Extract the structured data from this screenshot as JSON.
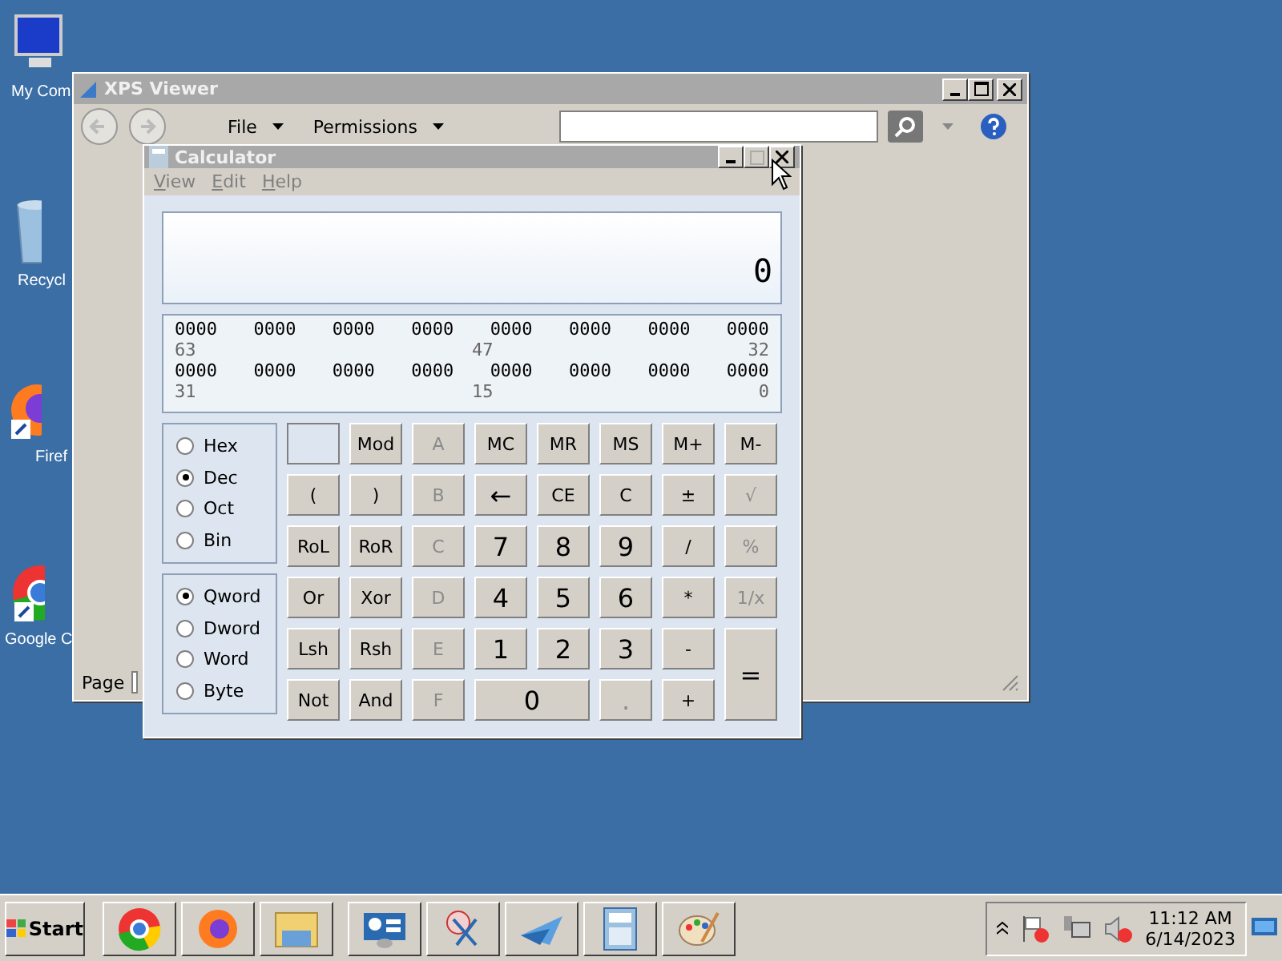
{
  "desktop_icons": [
    {
      "label": "My Com",
      "kind": "computer"
    },
    {
      "label": "Recycl",
      "kind": "bin"
    },
    {
      "label": "Firef",
      "kind": "firefox"
    },
    {
      "label": "Google C",
      "kind": "chrome"
    }
  ],
  "xps_viewer": {
    "title": "XPS Viewer",
    "menu": [
      "File",
      "Permissions"
    ],
    "page_label": "Page"
  },
  "calculator": {
    "title": "Calculator",
    "menu": [
      "View",
      "Edit",
      "Help"
    ],
    "display": "0",
    "bit_rows": [
      {
        "groups": [
          "0000",
          "0000",
          "0000",
          "0000",
          "0000",
          "0000",
          "0000",
          "0000"
        ],
        "marks": [
          "63",
          "47",
          "32"
        ]
      },
      {
        "groups": [
          "0000",
          "0000",
          "0000",
          "0000",
          "0000",
          "0000",
          "0000",
          "0000"
        ],
        "marks": [
          "31",
          "15",
          "0"
        ]
      }
    ],
    "radix": [
      {
        "label": "Hex",
        "selected": false
      },
      {
        "label": "Dec",
        "selected": true
      },
      {
        "label": "Oct",
        "selected": false
      },
      {
        "label": "Bin",
        "selected": false
      }
    ],
    "word_size": [
      {
        "label": "Qword",
        "selected": true
      },
      {
        "label": "Dword",
        "selected": false
      },
      {
        "label": "Word",
        "selected": false
      },
      {
        "label": "Byte",
        "selected": false
      }
    ],
    "keys": [
      {
        "kind": "indicator"
      },
      {
        "kind": "key",
        "label": "Mod",
        "disabled": false
      },
      {
        "kind": "key",
        "label": "A",
        "disabled": true
      },
      {
        "kind": "key",
        "label": "MC",
        "disabled": false
      },
      {
        "kind": "key",
        "label": "MR",
        "disabled": false
      },
      {
        "kind": "key",
        "label": "MS",
        "disabled": false
      },
      {
        "kind": "key",
        "label": "M+",
        "disabled": false
      },
      {
        "kind": "key",
        "label": "M-",
        "disabled": false
      },
      {
        "kind": "key",
        "label": "(",
        "disabled": false
      },
      {
        "kind": "key",
        "label": ")",
        "disabled": false
      },
      {
        "kind": "key",
        "label": "B",
        "disabled": true
      },
      {
        "kind": "key",
        "label": "←",
        "disabled": false
      },
      {
        "kind": "key",
        "label": "CE",
        "disabled": false
      },
      {
        "kind": "key",
        "label": "C",
        "disabled": false
      },
      {
        "kind": "key",
        "label": "±",
        "disabled": false
      },
      {
        "kind": "key",
        "label": "√",
        "disabled": true
      },
      {
        "kind": "key",
        "label": "RoL",
        "disabled": false
      },
      {
        "kind": "key",
        "label": "RoR",
        "disabled": false
      },
      {
        "kind": "key",
        "label": "C",
        "disabled": true
      },
      {
        "kind": "key",
        "label": "7",
        "disabled": false
      },
      {
        "kind": "key",
        "label": "8",
        "disabled": false
      },
      {
        "kind": "key",
        "label": "9",
        "disabled": false
      },
      {
        "kind": "key",
        "label": "/",
        "disabled": false
      },
      {
        "kind": "key",
        "label": "%",
        "disabled": true
      },
      {
        "kind": "key",
        "label": "Or",
        "disabled": false
      },
      {
        "kind": "key",
        "label": "Xor",
        "disabled": false
      },
      {
        "kind": "key",
        "label": "D",
        "disabled": true
      },
      {
        "kind": "key",
        "label": "4",
        "disabled": false
      },
      {
        "kind": "key",
        "label": "5",
        "disabled": false
      },
      {
        "kind": "key",
        "label": "6",
        "disabled": false
      },
      {
        "kind": "key",
        "label": "*",
        "disabled": false
      },
      {
        "kind": "key",
        "label": "1/x",
        "disabled": true
      },
      {
        "kind": "key",
        "label": "Lsh",
        "disabled": false
      },
      {
        "kind": "key",
        "label": "Rsh",
        "disabled": false
      },
      {
        "kind": "key",
        "label": "E",
        "disabled": true
      },
      {
        "kind": "key",
        "label": "1",
        "disabled": false
      },
      {
        "kind": "key",
        "label": "2",
        "disabled": false
      },
      {
        "kind": "key",
        "label": "3",
        "disabled": false
      },
      {
        "kind": "key",
        "label": "-",
        "disabled": false
      },
      {
        "kind": "tall",
        "label": "=",
        "disabled": false
      },
      {
        "kind": "key",
        "label": "Not",
        "disabled": false
      },
      {
        "kind": "key",
        "label": "And",
        "disabled": false
      },
      {
        "kind": "key",
        "label": "F",
        "disabled": true
      },
      {
        "kind": "wide",
        "label": "0",
        "disabled": false
      },
      {
        "kind": "key",
        "label": ".",
        "disabled": true
      },
      {
        "kind": "key",
        "label": "+",
        "disabled": false
      }
    ]
  },
  "taskbar": {
    "start": "Start",
    "time": "11:12 AM",
    "date": "6/14/2023"
  }
}
